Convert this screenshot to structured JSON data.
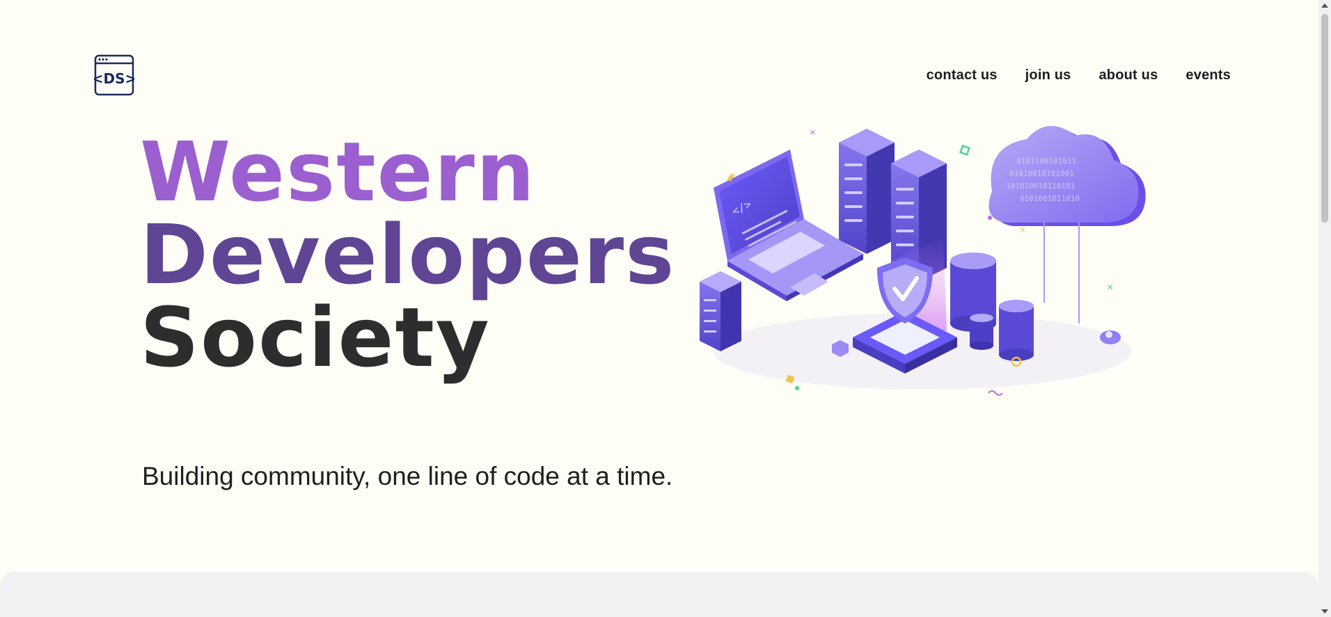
{
  "logo": {
    "text": "<DS>",
    "icon": "browser-window-code-icon",
    "color": "#1b2a5e"
  },
  "nav": {
    "items": [
      {
        "label": "contact us"
      },
      {
        "label": "join us"
      },
      {
        "label": "about us"
      },
      {
        "label": "events"
      }
    ]
  },
  "hero": {
    "title_line1": "Western",
    "title_line2": "Developers",
    "title_line3": "Society",
    "tagline": "Building community, one line of code at a time.",
    "illustration": "isometric-datacenter-illustration",
    "colors": {
      "line1": "#9b5fd0",
      "line2": "#5f4593",
      "line3": "#2d2d2d",
      "accent": "#6a5af9"
    }
  }
}
